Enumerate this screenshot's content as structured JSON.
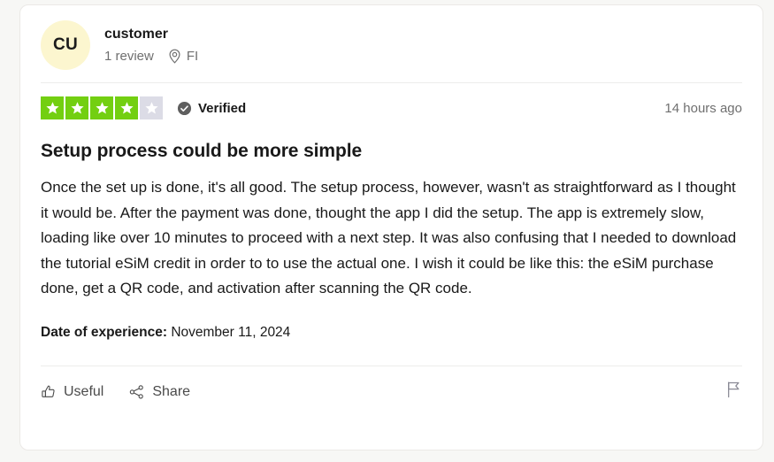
{
  "card": {
    "consumer": {
      "avatar_initials": "CU",
      "avatar_color": "#fcf6cf",
      "name": "customer",
      "review_count": "1 review",
      "location_code": "FI",
      "location_icon": "map-pin-icon"
    },
    "rating": {
      "value": 4,
      "max": 5,
      "star_on_color": "#73cf11",
      "star_off_color": "#dcdce6",
      "verified_label": "Verified",
      "verified_icon": "check-circle-icon",
      "timestamp": "14 hours ago"
    },
    "review": {
      "title": "Setup process could be more simple",
      "body": "Once the set up is done, it's all good. The setup process, however, wasn't as straightforward as I thought it would be. After the payment was done, thought the app I did the setup. The app is extremely slow, loading like over 10 minutes to proceed with a next step. It was also confusing that I needed to download the tutorial eSiM credit in order to to use the actual one. I wish it could be like this: the eSiM purchase done, get a QR code, and activation after scanning the QR code.",
      "experience_label": "Date of experience:",
      "experience_date": "November 11, 2024"
    },
    "actions": {
      "useful_label": "Useful",
      "useful_icon": "thumbs-up-icon",
      "share_label": "Share",
      "share_icon": "share-nodes-icon",
      "report_icon": "flag-icon"
    }
  }
}
